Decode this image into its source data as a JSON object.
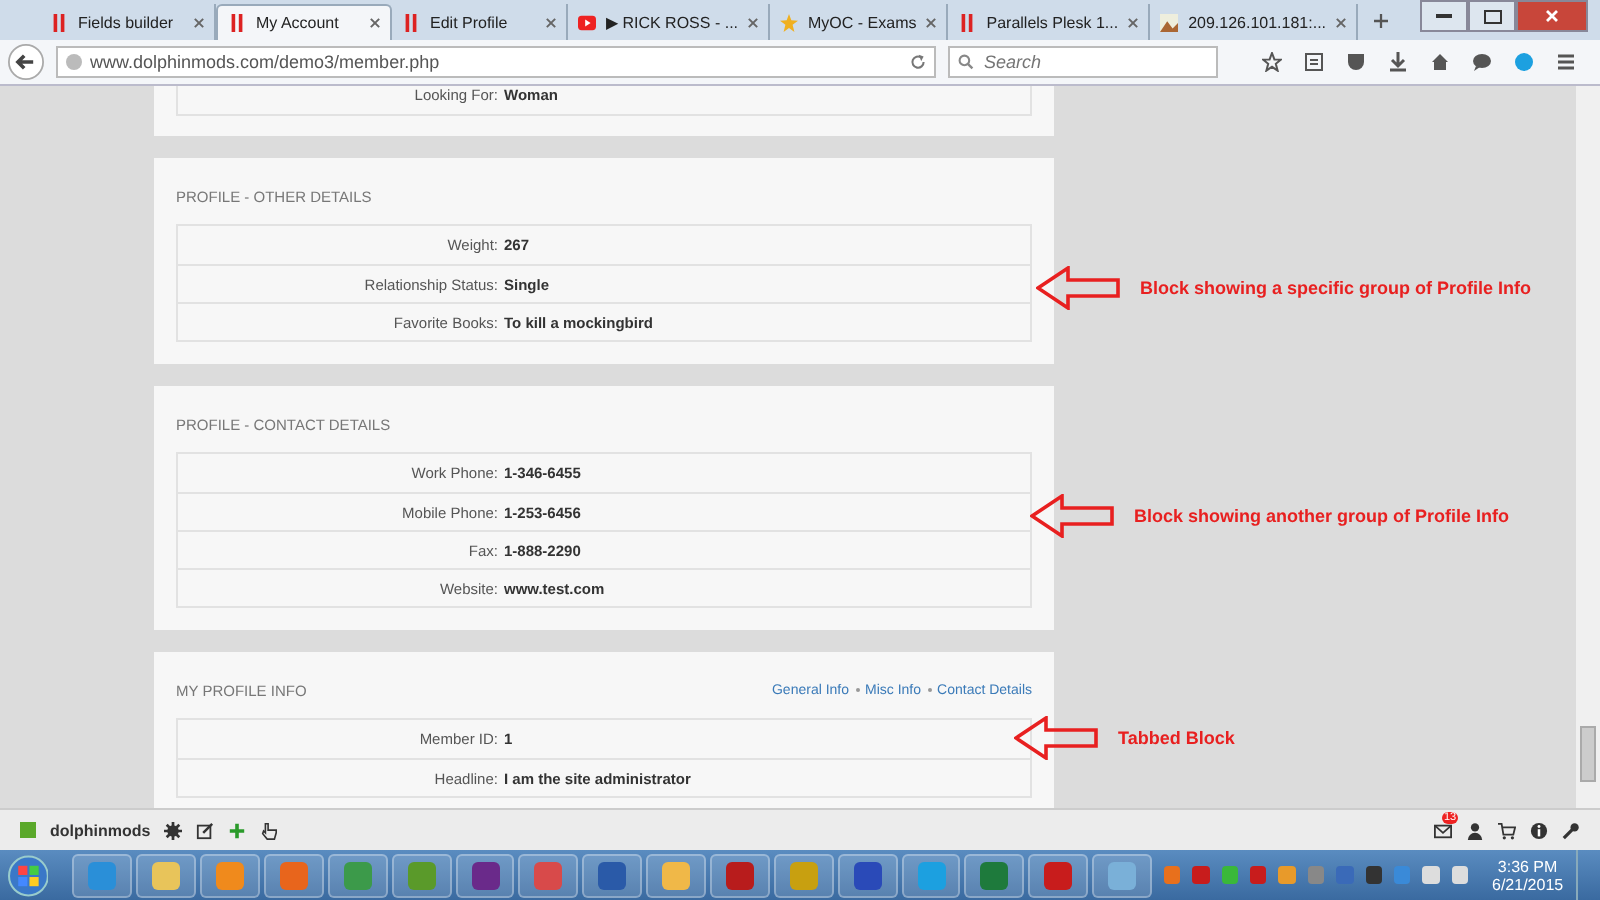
{
  "browser": {
    "tabs": [
      {
        "label": "Fields builder",
        "kind": "bars",
        "selected": false
      },
      {
        "label": "My Account",
        "kind": "bars",
        "selected": true
      },
      {
        "label": "Edit Profile",
        "kind": "bars",
        "selected": false
      },
      {
        "label": "▶ RICK ROSS - ...",
        "kind": "video",
        "selected": false
      },
      {
        "label": "MyOC - Exams",
        "kind": "star",
        "selected": false
      },
      {
        "label": "Parallels Plesk 1...",
        "kind": "bars",
        "selected": false
      },
      {
        "label": "209.126.101.181:...",
        "kind": "image",
        "selected": false
      }
    ],
    "url": "www.dolphinmods.com/demo3/member.php",
    "search": {
      "placeholder": "Search"
    }
  },
  "blocks": [
    {
      "rows": [
        {
          "label": "Looking For:",
          "value": "Woman"
        }
      ]
    },
    {
      "title": "PROFILE - OTHER DETAILS",
      "rows": [
        {
          "label": "Weight:",
          "value": "267"
        },
        {
          "label": "Relationship Status:",
          "value": "Single"
        },
        {
          "label": "Favorite Books:",
          "value": "To kill a mockingbird"
        }
      ]
    },
    {
      "title": "PROFILE - CONTACT DETAILS",
      "rows": [
        {
          "label": "Work Phone:",
          "value": "1-346-6455"
        },
        {
          "label": "Mobile Phone:",
          "value": "1-253-6456"
        },
        {
          "label": "Fax:",
          "value": "1-888-2290"
        },
        {
          "label": "Website:",
          "value": "www.test.com"
        }
      ]
    },
    {
      "title": "MY PROFILE INFO",
      "tabs": [
        {
          "label": "General Info",
          "selected": false
        },
        {
          "label": "Misc Info",
          "selected": false
        },
        {
          "label": "Contact Details",
          "selected": false
        }
      ],
      "rows": [
        {
          "label": "Member ID:",
          "value": "1"
        },
        {
          "label": "Headline:",
          "value": "I am the site administrator"
        }
      ]
    }
  ],
  "annotations": [
    "Block showing a specific group of Profile Info",
    "Block showing another group of Profile Info",
    "Tabbed Block"
  ],
  "toolbar": {
    "site": "dolphinmods",
    "badge": "13"
  },
  "clock": {
    "time": "3:36 PM",
    "date": "6/21/2015"
  }
}
